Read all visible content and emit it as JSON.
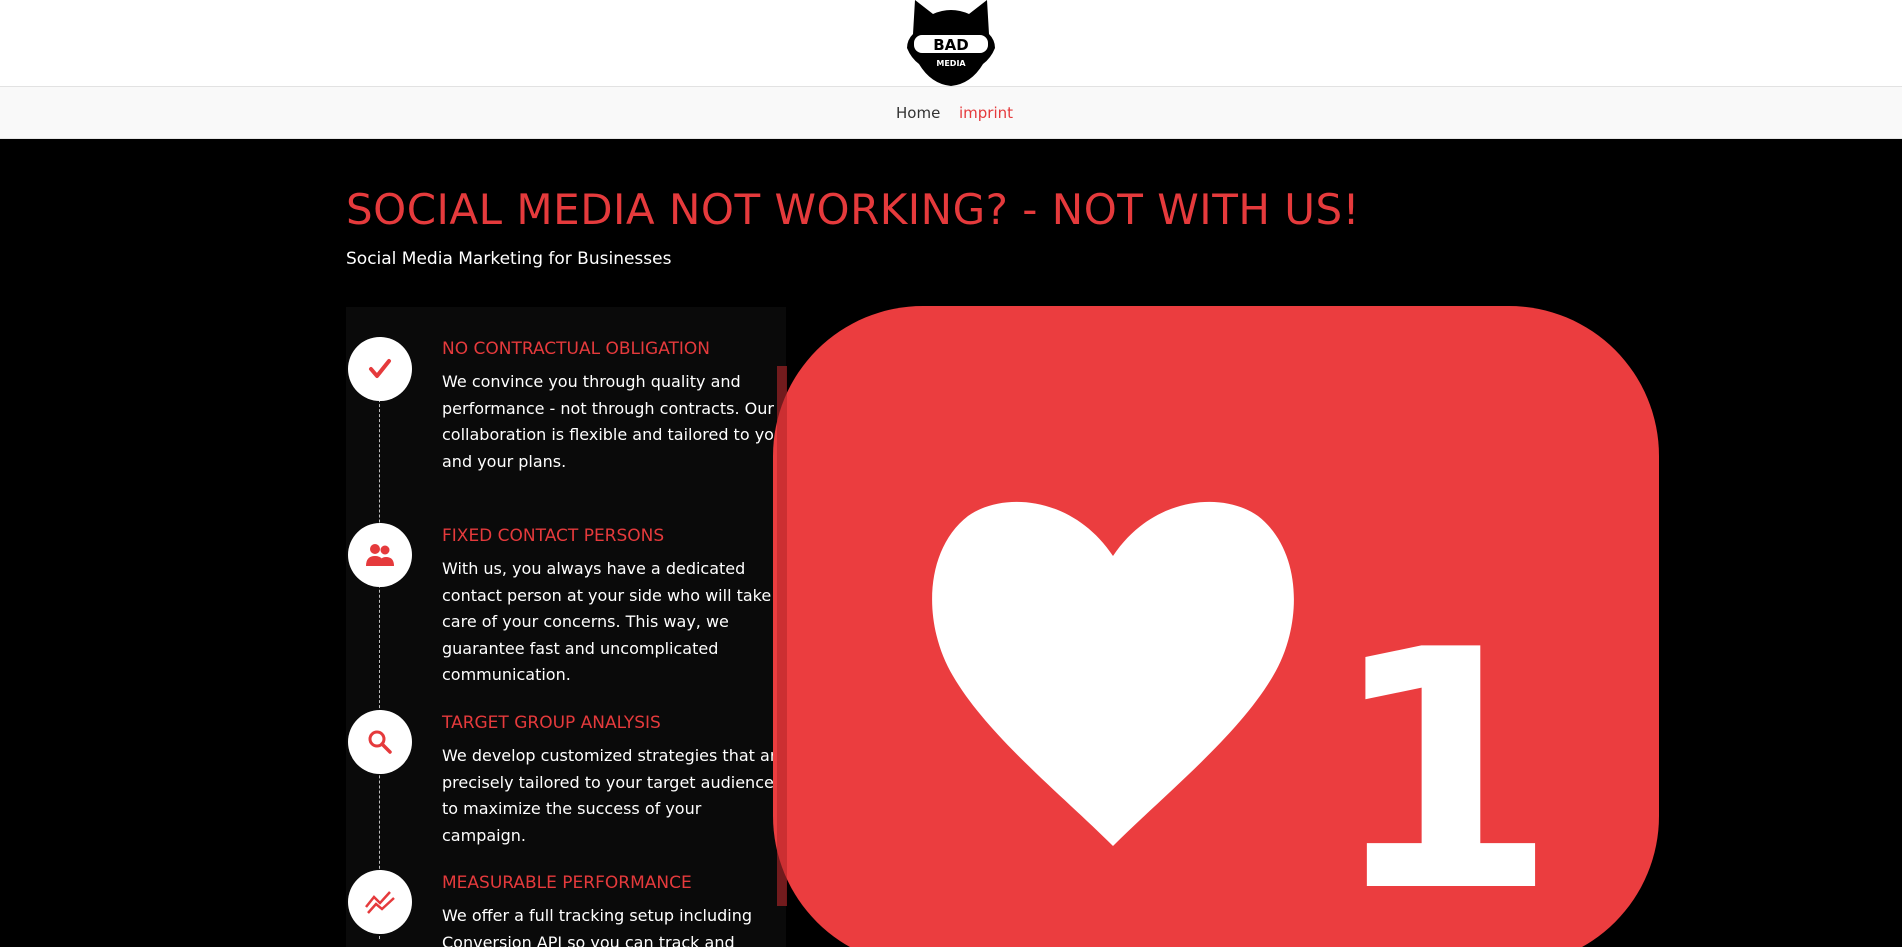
{
  "header": {
    "logo_top": "BAD",
    "logo_bottom": "MEDIA"
  },
  "nav": {
    "items": [
      {
        "label": "Home",
        "active": false
      },
      {
        "label": "imprint",
        "active": true
      }
    ]
  },
  "hero": {
    "title": "SOCIAL MEDIA NOT WORKING? - NOT WITH US!",
    "subtitle": "Social Media Marketing for Businesses",
    "features": [
      {
        "icon": "checkmark-icon",
        "title": "NO CONTRACTUAL OBLIGATION",
        "text": "We convince you through quality and performance - not through contracts. Our collaboration is flexible and tailored to you and your plans."
      },
      {
        "icon": "people-icon",
        "title": "FIXED CONTACT PERSONS",
        "text": "With us, you always have a dedicated contact person at your side who will take care of your concerns. This way, we guarantee fast and uncomplicated communication."
      },
      {
        "icon": "search-icon",
        "title": "TARGET GROUP ANALYSIS",
        "text": "We develop customized strategies that are precisely tailored to your target audience to maximize the success of your campaign."
      },
      {
        "icon": "trend-chart-icon",
        "title": "MEASURABLE PERFORMANCE",
        "text": "We offer a full tracking setup including Conversion API so you can track and optimize"
      }
    ],
    "like_badge": {
      "icon": "heart-icon",
      "count": "1"
    }
  },
  "colors": {
    "accent": "#e53a3c",
    "badge": "#eb3d3f",
    "background": "#000000",
    "nav_background": "#f9f9f9"
  }
}
